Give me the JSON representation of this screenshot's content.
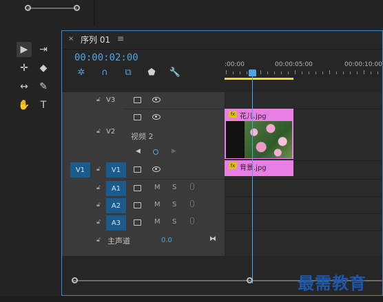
{
  "sequence": {
    "tab_close": "×",
    "tab_title": "序列 01",
    "tab_menu": "≡",
    "timecode": "00:00:02:00"
  },
  "ruler": {
    "labels": [
      ":00:00",
      "00:00:05:00",
      "00:00:10:00"
    ]
  },
  "tracks": {
    "video": [
      {
        "name": "V3"
      },
      {
        "name": "V2",
        "label": "视频 2"
      },
      {
        "name": "V1",
        "source_target": "V1"
      }
    ],
    "audio": [
      {
        "name": "A1",
        "mute": "M",
        "solo": "S"
      },
      {
        "name": "A2",
        "mute": "M",
        "solo": "S"
      },
      {
        "name": "A3",
        "mute": "M",
        "solo": "S"
      }
    ],
    "master": {
      "label": "主声道",
      "value": "0.0"
    }
  },
  "clips": {
    "flower": "花儿.jpg",
    "background": "背景.jpg",
    "fx": "fx"
  },
  "watermark": "最需教育",
  "colors": {
    "accent": "#4da4e6",
    "clip": "#e97fe4",
    "track_target": "#1b5b8c",
    "work_area": "#e9e31b"
  }
}
